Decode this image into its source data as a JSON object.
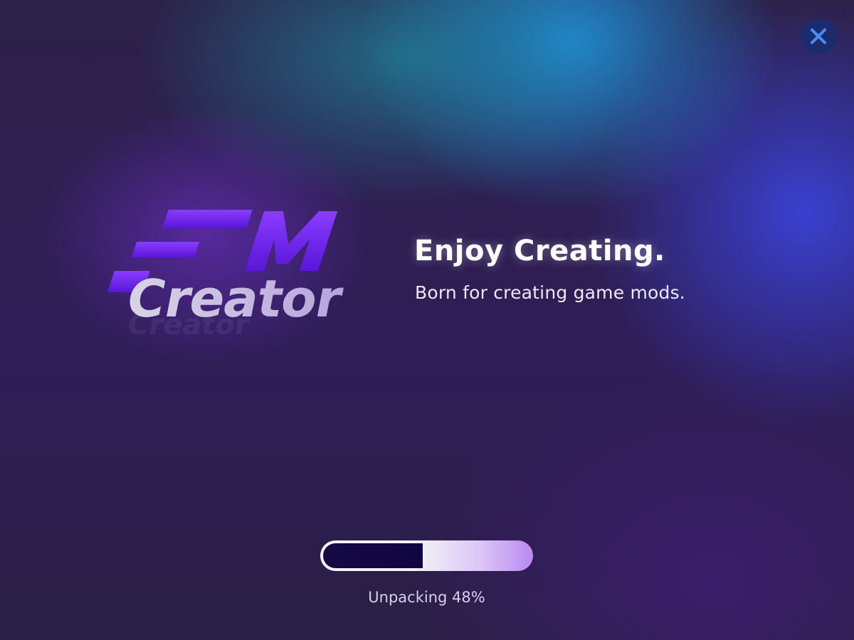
{
  "window": {
    "close_icon": "close-icon"
  },
  "logo": {
    "line1": "FM",
    "line2": "Creator"
  },
  "hero": {
    "headline": "Enjoy Creating.",
    "subline": "Born for creating game mods."
  },
  "progress": {
    "status_label": "Unpacking 48%",
    "fraction": 0.48
  },
  "colors": {
    "accent_purple": "#7b2ff7",
    "progress_fill": "#150a43",
    "close_bg": "#1c2a6e"
  }
}
